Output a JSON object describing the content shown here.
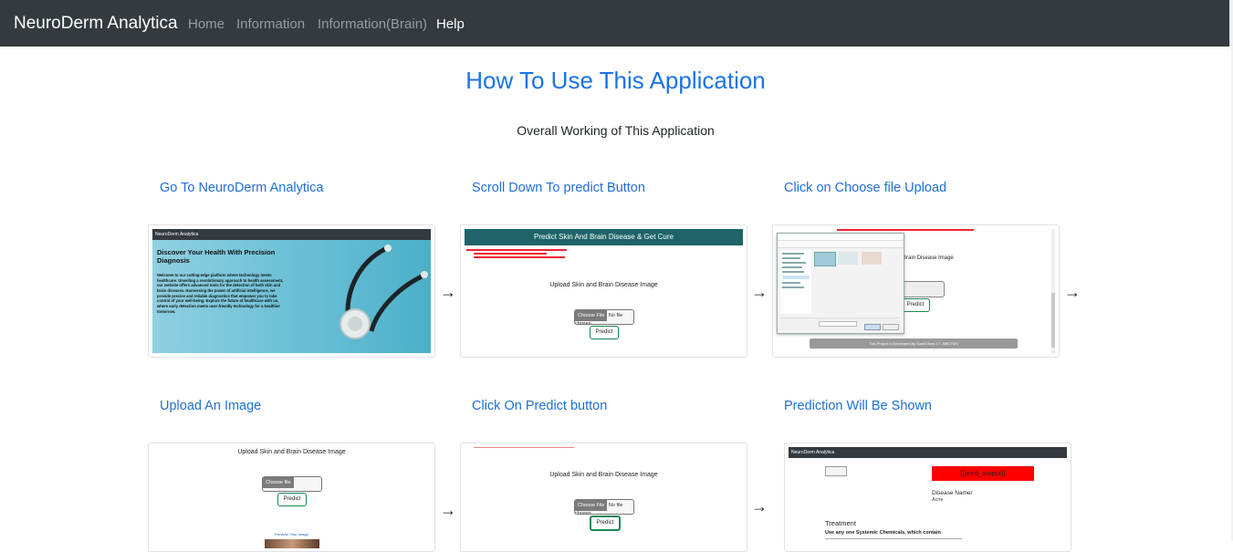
{
  "navbar": {
    "brand": "NeuroDerm Analytica",
    "links": [
      {
        "label": "Home"
      },
      {
        "label": "Information"
      },
      {
        "label": "Information(Brain)"
      },
      {
        "label": "Help"
      }
    ]
  },
  "page": {
    "title": "How To Use This Application",
    "subtitle": "Overall Working of This Application"
  },
  "steps": [
    {
      "title": "Go To NeuroDerm Analytica"
    },
    {
      "title": "Scroll Down To predict Button"
    },
    {
      "title": "Click on Choose file Upload"
    },
    {
      "title": "Upload An Image"
    },
    {
      "title": "Click On Predict button"
    },
    {
      "title": "Prediction Will Be Shown"
    }
  ],
  "arrow_glyph": "→",
  "screens": {
    "s1": {
      "nav": "NeuroDerm Analytica",
      "heading": "Discover Your Health With Precision Diagnosis",
      "body": "Welcome to our cutting-edge platform where technology meets healthcare. Unveiling a revolutionary approach to health assessment, our website offers advanced tools for the detection of both skin and brain diseases. Harnessing the power of artificial intelligence, we provide precise and reliable diagnostics that empower you to take control of your well-being. Explore the future of healthcare with us, where early detection meets user-friendly technology for a healthier tomorrow."
    },
    "s2": {
      "banner": "Predict Skin And Brain Disease & Get Cure",
      "upload": "Upload Skin and Brain Disease Image",
      "choose": "Choose File",
      "nofile": "No file chosen",
      "predict": "Predict"
    },
    "s3": {
      "upload": "Brain Disease Image",
      "predict": "Predict",
      "footer": "This Project is Developed by Sushil Bera I.T., BBCTMS"
    },
    "s4": {
      "upload": "Upload Skin and Brain Disease Image",
      "choose": "Choose file",
      "predict": "Predict",
      "preview": "Preview: Your Image"
    },
    "s5": {
      "upload": "Upload Skin and Brain Disease Image",
      "choose": "Choose File",
      "nofile": "No file chosen",
      "predict": "Predict"
    },
    "s6": {
      "nav": "NeuroDerm Analytica",
      "output": "{{pred_output}}",
      "disease": "Disease Name/",
      "acne": "Acne",
      "treatment": "Treatment",
      "systemic": "Use any one Systemic Chemicals, which contain"
    }
  },
  "colors": {
    "navbar_bg": "#343a40",
    "accent": "#1a73e8",
    "banner": "#1e6468",
    "output_red": "#ff0000"
  }
}
